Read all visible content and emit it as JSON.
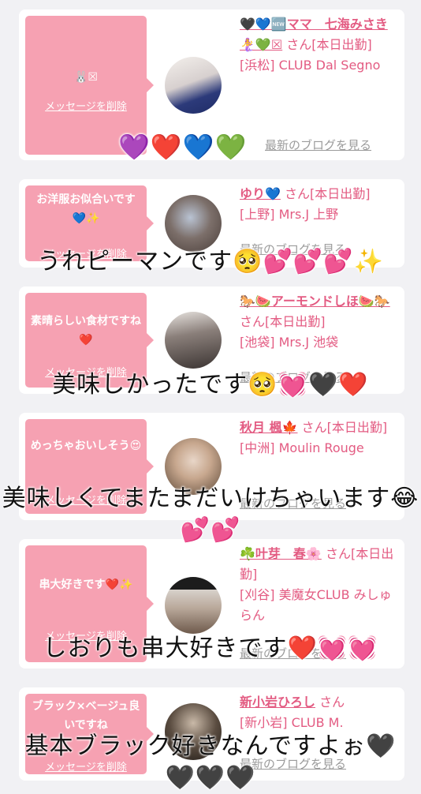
{
  "cards": [
    {
      "bubble_text": "🐰☒",
      "delete_label": "メッセージを削除",
      "name": "🖤💙🆕ママ　七海みさき🧜‍♀️💚☒",
      "suffix": "さん[本日出勤]",
      "shop": "[浜松] CLUB Dal Segno",
      "blog": "最新のブログを見る"
    },
    {
      "bubble_text": "お洋服お似合いです💙✨",
      "delete_label": "メッセージを削除",
      "name": "ゆり💙",
      "suffix": "さん[本日出勤]",
      "shop": "[上野] Mrs.J 上野",
      "blog": "最新のブログを見る"
    },
    {
      "bubble_text": "素晴らしい食材ですね❤️",
      "delete_label": "メッセージを削除",
      "name": "🐎🍉アーモンドしほ🍉🐎",
      "suffix": "さん[本日出勤]",
      "shop": "[池袋] Mrs.J 池袋",
      "blog": "最新のブログを見る"
    },
    {
      "bubble_text": "めっちゃおいしそう😍",
      "delete_label": "メッセージを削除",
      "name": "秋月 楓🍁",
      "suffix": "さん[本日出勤]",
      "shop": "[中洲] Moulin Rouge",
      "blog": "最新のブログを見る"
    },
    {
      "bubble_text": "串大好きです❤️✨",
      "delete_label": "メッセージを削除",
      "name": "☘️叶芽　春🌸",
      "suffix": "さん[本日出勤]",
      "shop": "[刈谷] 美魔女CLUB みしゅらん",
      "blog": "最新のブログを見る"
    },
    {
      "bubble_text": "ブラック×ベージュ良いですね",
      "delete_label": "メッセージを削除",
      "name": "新小岩ひろし",
      "suffix": "さん",
      "shop": "[新小岩] CLUB M.",
      "blog": "最新のブログを見る"
    }
  ],
  "overlays": {
    "hearts_top": "💜❤️💙💚",
    "caption_1": "うれピーマンです🥺💕💕💕✨",
    "caption_2": "美味しかったです🥺💓🖤❤️",
    "caption_3": "美味しくてまたまだいけちゃいます😂💕💕",
    "caption_4": "しおりも串大好きです❤️💓💓",
    "caption_5": "基本ブラック好きなんですよぉ🖤\n🖤🖤🖤"
  },
  "colors": {
    "bubble": "#f6a1b2",
    "name": "#e35b82",
    "background": "#f1f1f4"
  }
}
